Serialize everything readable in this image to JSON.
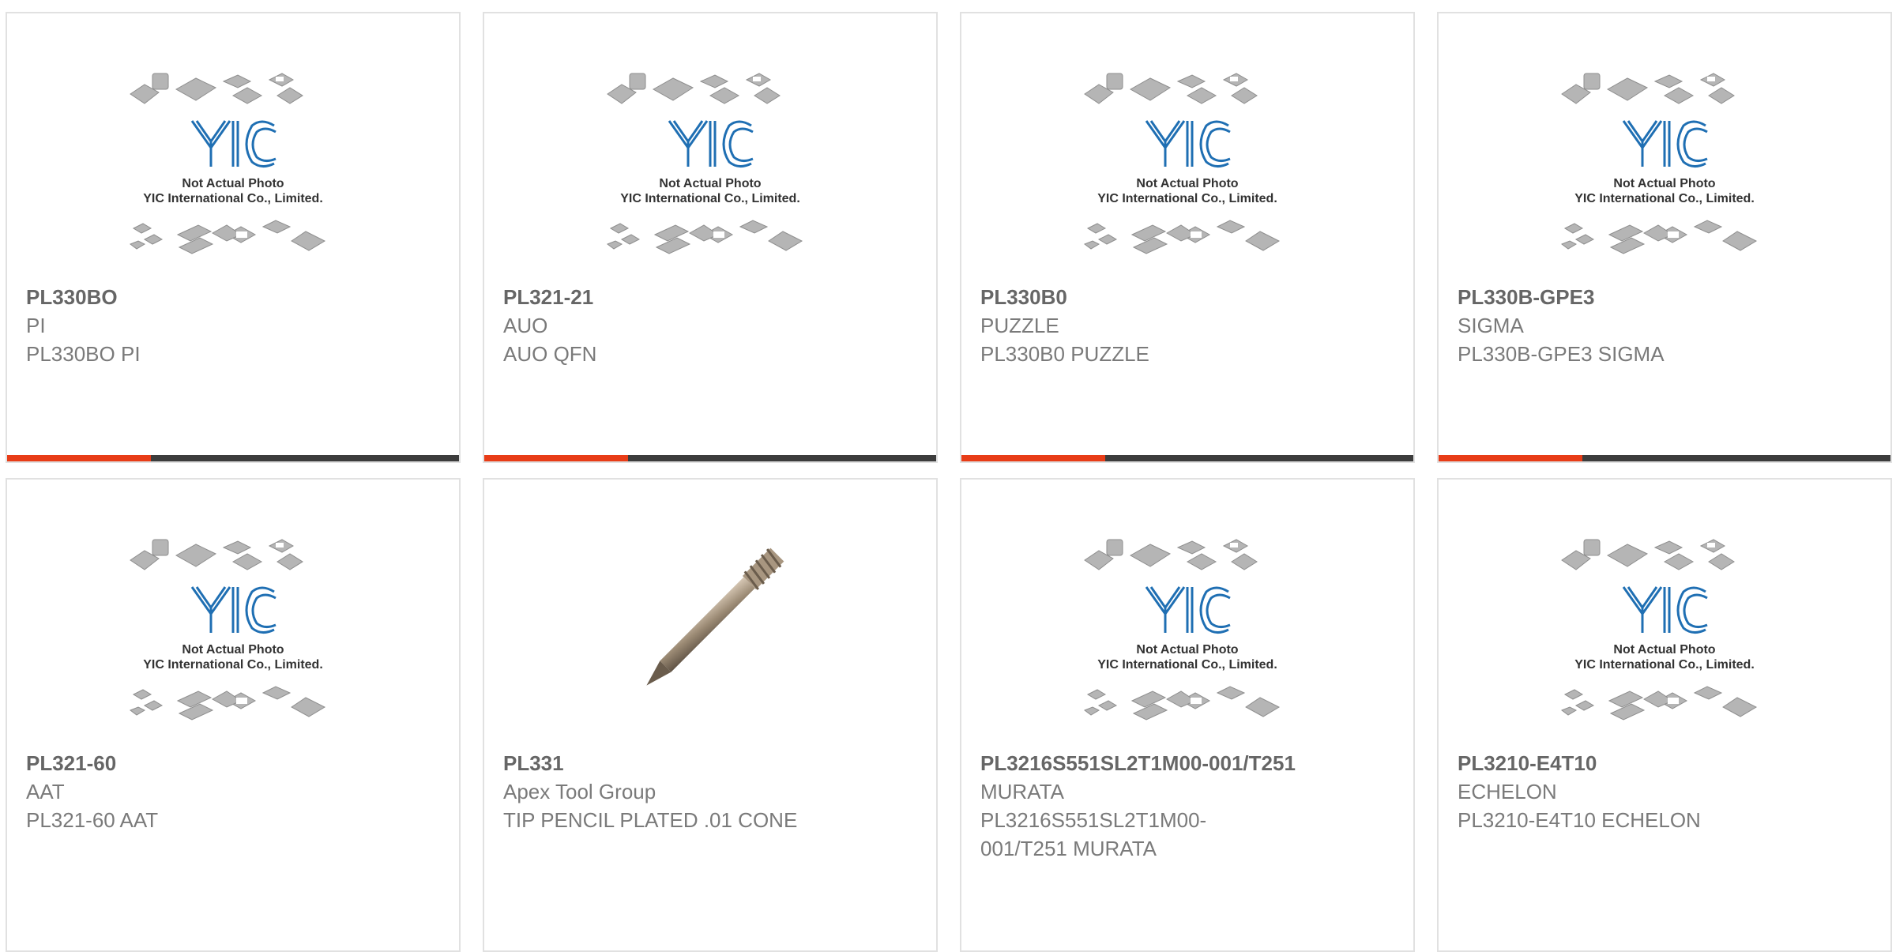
{
  "placeholder": {
    "line1": "Not Actual Photo",
    "line2": "YIC International Co., Limited."
  },
  "colors": {
    "accent": "#e83c17",
    "bar": "#3c3c3c",
    "logo_blue": "#1f6fb3",
    "border": "#e1e1e1"
  },
  "products": [
    {
      "part_number": "PL330BO",
      "manufacturer": "PI",
      "description": "PL330BO PI",
      "image": "placeholder"
    },
    {
      "part_number": "PL321-21",
      "manufacturer": "AUO",
      "description": "AUO QFN",
      "image": "placeholder"
    },
    {
      "part_number": "PL330B0",
      "manufacturer": "PUZZLE",
      "description": "PL330B0 PUZZLE",
      "image": "placeholder"
    },
    {
      "part_number": "PL330B-GPE3",
      "manufacturer": "SIGMA",
      "description": "PL330B-GPE3 SIGMA",
      "image": "placeholder"
    },
    {
      "part_number": "PL321-60",
      "manufacturer": "AAT",
      "description": "PL321-60 AAT",
      "image": "placeholder"
    },
    {
      "part_number": "PL331",
      "manufacturer": "Apex Tool Group",
      "description": "TIP PENCIL PLATED .01 CONE",
      "image": "solder-tip"
    },
    {
      "part_number": "PL3216S551SL2T1M00-001/T251",
      "manufacturer": "MURATA",
      "description": "PL3216S551SL2T1M00-001/T251 MURATA",
      "image": "placeholder"
    },
    {
      "part_number": "PL3210-E4T10",
      "manufacturer": "ECHELON",
      "description": "PL3210-E4T10 ECHELON",
      "image": "placeholder"
    }
  ]
}
